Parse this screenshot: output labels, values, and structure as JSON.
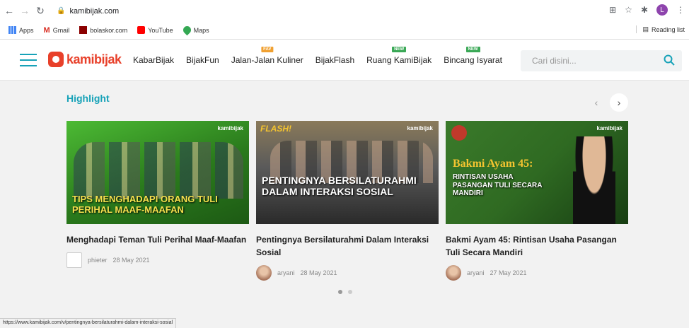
{
  "browser": {
    "url": "kamibijak.com",
    "profile_initial": "L",
    "bookmarks": [
      {
        "label": "Apps",
        "icon": "apps-grid-icon"
      },
      {
        "label": "Gmail",
        "icon": "gmail-icon"
      },
      {
        "label": "bolaskor.com",
        "icon": "bolaskor-icon"
      },
      {
        "label": "YouTube",
        "icon": "youtube-icon"
      },
      {
        "label": "Maps",
        "icon": "maps-icon"
      }
    ],
    "reading_list": "Reading list"
  },
  "header": {
    "logo_text": "kamibijak",
    "menu": [
      {
        "label": "KabarBijak",
        "badge": ""
      },
      {
        "label": "BijakFun",
        "badge": ""
      },
      {
        "label": "Jalan-Jalan Kuliner",
        "badge": "FAV"
      },
      {
        "label": "BijakFlash",
        "badge": ""
      },
      {
        "label": "Ruang KamiBijak",
        "badge": "NEW"
      },
      {
        "label": "Bincang Isyarat",
        "badge": "NEW"
      }
    ],
    "search_placeholder": "Cari disini..."
  },
  "highlight": {
    "title": "Highlight",
    "prev": "‹",
    "next": "›",
    "cards": [
      {
        "title": "Menghadapi Teman Tuli Perihal Maaf-Maafan",
        "author": "phieter",
        "date": "28 May 2021",
        "thumb_caption": "TIPS MENGHADAPI ORANG TULI PERIHAL MAAF-MAAFAN",
        "thumb_brand": "kamibijak",
        "colors": [
          "#3a9a2a",
          "#1d5a14"
        ]
      },
      {
        "title": "Pentingnya Bersilaturahmi Dalam Interaksi Sosial",
        "author": "aryani",
        "date": "28 May 2021",
        "thumb_tag": "FLASH!",
        "thumb_caption": "PENTINGNYA BERSILATURAHMI DALAM INTERAKSI SOSIAL",
        "thumb_brand": "kamibijak",
        "colors": [
          "#5a5a5a",
          "#2a2a2a"
        ]
      },
      {
        "title": "Bakmi Ayam 45: Rintisan Usaha Pasangan Tuli Secara Mandiri",
        "author": "aryani",
        "date": "27 May 2021",
        "thumb_heading": "Bakmi Ayam 45:",
        "thumb_caption": "RINTISAN USAHA PASANGAN TULI SECARA MANDIRI",
        "thumb_brand": "kamibijak",
        "colors": [
          "#2f6a22",
          "#173d12"
        ]
      }
    ],
    "pager": {
      "active": 1,
      "total": 2
    }
  },
  "status_bar_url": "https://www.kamibijak.com/v/pentingnya-bersilaturahmi-dalam-interaksi-sosial"
}
